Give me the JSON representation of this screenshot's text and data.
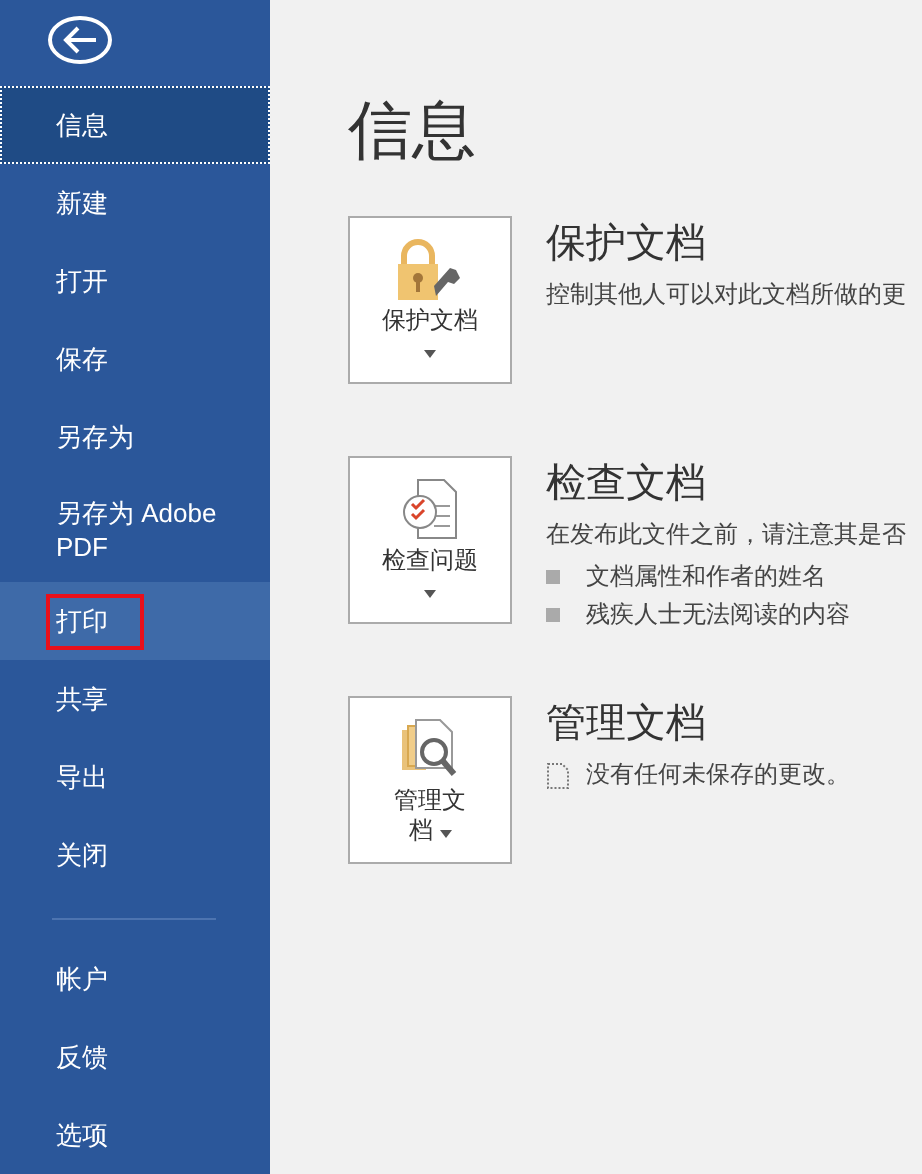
{
  "sidebar": {
    "items": [
      {
        "label": "信息",
        "selected": true,
        "hovered": false,
        "marked": false
      },
      {
        "label": "新建",
        "selected": false,
        "hovered": false,
        "marked": false
      },
      {
        "label": "打开",
        "selected": false,
        "hovered": false,
        "marked": false
      },
      {
        "label": "保存",
        "selected": false,
        "hovered": false,
        "marked": false
      },
      {
        "label": "另存为",
        "selected": false,
        "hovered": false,
        "marked": false
      },
      {
        "label": "另存为 Adobe PDF",
        "selected": false,
        "hovered": false,
        "marked": false
      },
      {
        "label": "打印",
        "selected": false,
        "hovered": true,
        "marked": true
      },
      {
        "label": "共享",
        "selected": false,
        "hovered": false,
        "marked": false
      },
      {
        "label": "导出",
        "selected": false,
        "hovered": false,
        "marked": false
      },
      {
        "label": "关闭",
        "selected": false,
        "hovered": false,
        "marked": false
      }
    ],
    "footer_items": [
      {
        "label": "帐户",
        "selected": false,
        "hovered": false,
        "marked": false
      },
      {
        "label": "反馈",
        "selected": false,
        "hovered": false,
        "marked": false
      },
      {
        "label": "选项",
        "selected": false,
        "hovered": false,
        "marked": false
      }
    ]
  },
  "page_title": "信息",
  "sections": [
    {
      "kind": "protect",
      "button": "保护文档",
      "heading": "保护文档",
      "description": "控制其他人可以对此文档所做的更"
    },
    {
      "kind": "inspect",
      "button": "检查问题",
      "heading": "检查文档",
      "description": "在发布此文件之前，请注意其是否",
      "bullets": [
        "文档属性和作者的姓名",
        "残疾人士无法阅读的内容"
      ]
    },
    {
      "kind": "manage",
      "button": "管理文档",
      "heading": "管理文档",
      "note": "没有任何未保存的更改。"
    }
  ]
}
